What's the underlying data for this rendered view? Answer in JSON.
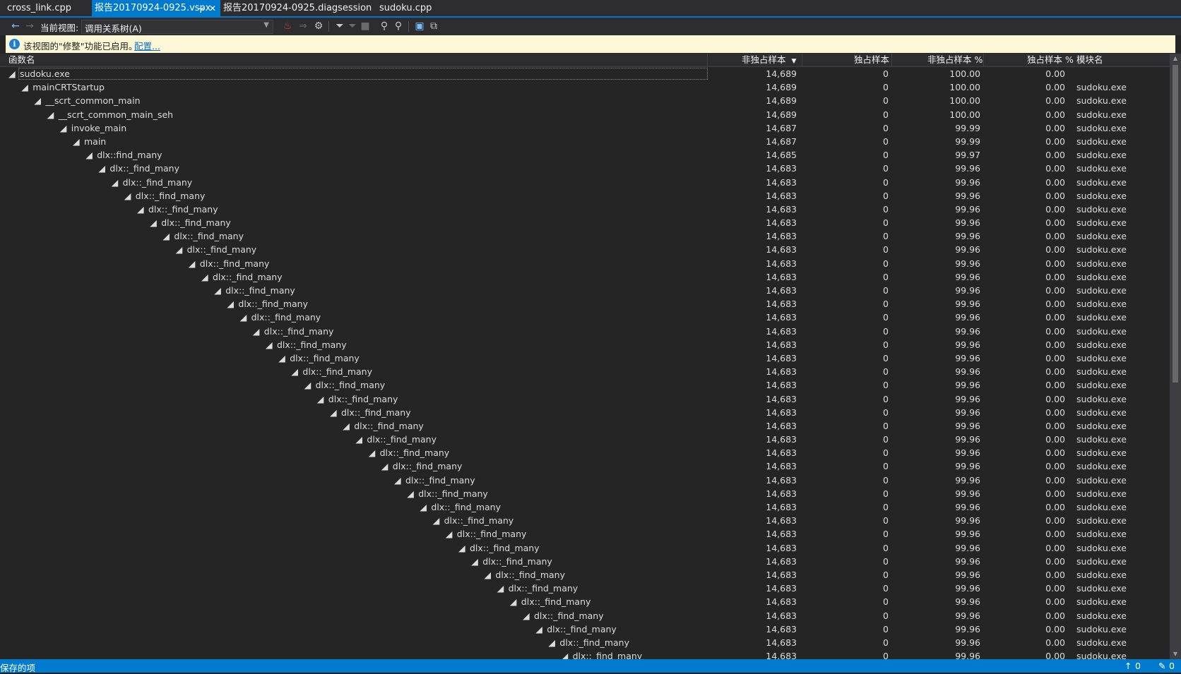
{
  "tabs": [
    {
      "label": "cross_link.cpp",
      "active": false
    },
    {
      "label": "报告20170924-0925.vspx",
      "active": true
    },
    {
      "label": "报告20170924-0925.diagsession",
      "active": false
    },
    {
      "label": "sudoku.cpp",
      "active": false
    }
  ],
  "toolbar": {
    "current_view_label": "当前视图:",
    "view_value": "调用关系树(A)"
  },
  "infobar": {
    "text": "该视图的\"修整\"功能已启用。",
    "link": "配置..."
  },
  "grid": {
    "columns": {
      "function": "函数名",
      "inclusive": "非独占样本",
      "exclusive": "独占样本",
      "inclusive_pct": "非独占样本 %",
      "exclusive_pct": "独占样本 %",
      "module": "模块名"
    },
    "rows": [
      {
        "name": "sudoku.exe",
        "incl": "14,689",
        "excl": "0",
        "inclp": "100.00",
        "exclp": "0.00",
        "module": ""
      },
      {
        "name": "mainCRTStartup",
        "incl": "14,689",
        "excl": "0",
        "inclp": "100.00",
        "exclp": "0.00",
        "module": "sudoku.exe"
      },
      {
        "name": "__scrt_common_main",
        "incl": "14,689",
        "excl": "0",
        "inclp": "100.00",
        "exclp": "0.00",
        "module": "sudoku.exe"
      },
      {
        "name": "__scrt_common_main_seh",
        "incl": "14,689",
        "excl": "0",
        "inclp": "100.00",
        "exclp": "0.00",
        "module": "sudoku.exe"
      },
      {
        "name": "invoke_main",
        "incl": "14,687",
        "excl": "0",
        "inclp": "99.99",
        "exclp": "0.00",
        "module": "sudoku.exe"
      },
      {
        "name": "main",
        "incl": "14,687",
        "excl": "0",
        "inclp": "99.99",
        "exclp": "0.00",
        "module": "sudoku.exe"
      },
      {
        "name": "dlx::find_many",
        "incl": "14,685",
        "excl": "0",
        "inclp": "99.97",
        "exclp": "0.00",
        "module": "sudoku.exe"
      },
      {
        "name": "dlx::_find_many",
        "incl": "14,683",
        "excl": "0",
        "inclp": "99.96",
        "exclp": "0.00",
        "module": "sudoku.exe"
      },
      {
        "name": "dlx::_find_many",
        "incl": "14,683",
        "excl": "0",
        "inclp": "99.96",
        "exclp": "0.00",
        "module": "sudoku.exe"
      },
      {
        "name": "dlx::_find_many",
        "incl": "14,683",
        "excl": "0",
        "inclp": "99.96",
        "exclp": "0.00",
        "module": "sudoku.exe"
      },
      {
        "name": "dlx::_find_many",
        "incl": "14,683",
        "excl": "0",
        "inclp": "99.96",
        "exclp": "0.00",
        "module": "sudoku.exe"
      },
      {
        "name": "dlx::_find_many",
        "incl": "14,683",
        "excl": "0",
        "inclp": "99.96",
        "exclp": "0.00",
        "module": "sudoku.exe"
      },
      {
        "name": "dlx::_find_many",
        "incl": "14,683",
        "excl": "0",
        "inclp": "99.96",
        "exclp": "0.00",
        "module": "sudoku.exe"
      },
      {
        "name": "dlx::_find_many",
        "incl": "14,683",
        "excl": "0",
        "inclp": "99.96",
        "exclp": "0.00",
        "module": "sudoku.exe"
      },
      {
        "name": "dlx::_find_many",
        "incl": "14,683",
        "excl": "0",
        "inclp": "99.96",
        "exclp": "0.00",
        "module": "sudoku.exe"
      },
      {
        "name": "dlx::_find_many",
        "incl": "14,683",
        "excl": "0",
        "inclp": "99.96",
        "exclp": "0.00",
        "module": "sudoku.exe"
      },
      {
        "name": "dlx::_find_many",
        "incl": "14,683",
        "excl": "0",
        "inclp": "99.96",
        "exclp": "0.00",
        "module": "sudoku.exe"
      },
      {
        "name": "dlx::_find_many",
        "incl": "14,683",
        "excl": "0",
        "inclp": "99.96",
        "exclp": "0.00",
        "module": "sudoku.exe"
      },
      {
        "name": "dlx::_find_many",
        "incl": "14,683",
        "excl": "0",
        "inclp": "99.96",
        "exclp": "0.00",
        "module": "sudoku.exe"
      },
      {
        "name": "dlx::_find_many",
        "incl": "14,683",
        "excl": "0",
        "inclp": "99.96",
        "exclp": "0.00",
        "module": "sudoku.exe"
      },
      {
        "name": "dlx::_find_many",
        "incl": "14,683",
        "excl": "0",
        "inclp": "99.96",
        "exclp": "0.00",
        "module": "sudoku.exe"
      },
      {
        "name": "dlx::_find_many",
        "incl": "14,683",
        "excl": "0",
        "inclp": "99.96",
        "exclp": "0.00",
        "module": "sudoku.exe"
      },
      {
        "name": "dlx::_find_many",
        "incl": "14,683",
        "excl": "0",
        "inclp": "99.96",
        "exclp": "0.00",
        "module": "sudoku.exe"
      },
      {
        "name": "dlx::_find_many",
        "incl": "14,683",
        "excl": "0",
        "inclp": "99.96",
        "exclp": "0.00",
        "module": "sudoku.exe"
      },
      {
        "name": "dlx::_find_many",
        "incl": "14,683",
        "excl": "0",
        "inclp": "99.96",
        "exclp": "0.00",
        "module": "sudoku.exe"
      },
      {
        "name": "dlx::_find_many",
        "incl": "14,683",
        "excl": "0",
        "inclp": "99.96",
        "exclp": "0.00",
        "module": "sudoku.exe"
      },
      {
        "name": "dlx::_find_many",
        "incl": "14,683",
        "excl": "0",
        "inclp": "99.96",
        "exclp": "0.00",
        "module": "sudoku.exe"
      },
      {
        "name": "dlx::_find_many",
        "incl": "14,683",
        "excl": "0",
        "inclp": "99.96",
        "exclp": "0.00",
        "module": "sudoku.exe"
      },
      {
        "name": "dlx::_find_many",
        "incl": "14,683",
        "excl": "0",
        "inclp": "99.96",
        "exclp": "0.00",
        "module": "sudoku.exe"
      },
      {
        "name": "dlx::_find_many",
        "incl": "14,683",
        "excl": "0",
        "inclp": "99.96",
        "exclp": "0.00",
        "module": "sudoku.exe"
      },
      {
        "name": "dlx::_find_many",
        "incl": "14,683",
        "excl": "0",
        "inclp": "99.96",
        "exclp": "0.00",
        "module": "sudoku.exe"
      },
      {
        "name": "dlx::_find_many",
        "incl": "14,683",
        "excl": "0",
        "inclp": "99.96",
        "exclp": "0.00",
        "module": "sudoku.exe"
      },
      {
        "name": "dlx::_find_many",
        "incl": "14,683",
        "excl": "0",
        "inclp": "99.96",
        "exclp": "0.00",
        "module": "sudoku.exe"
      },
      {
        "name": "dlx::_find_many",
        "incl": "14,683",
        "excl": "0",
        "inclp": "99.96",
        "exclp": "0.00",
        "module": "sudoku.exe"
      },
      {
        "name": "dlx::_find_many",
        "incl": "14,683",
        "excl": "0",
        "inclp": "99.96",
        "exclp": "0.00",
        "module": "sudoku.exe"
      },
      {
        "name": "dlx::_find_many",
        "incl": "14,683",
        "excl": "0",
        "inclp": "99.96",
        "exclp": "0.00",
        "module": "sudoku.exe"
      },
      {
        "name": "dlx::_find_many",
        "incl": "14,683",
        "excl": "0",
        "inclp": "99.96",
        "exclp": "0.00",
        "module": "sudoku.exe"
      },
      {
        "name": "dlx::_find_many",
        "incl": "14,683",
        "excl": "0",
        "inclp": "99.96",
        "exclp": "0.00",
        "module": "sudoku.exe"
      },
      {
        "name": "dlx::_find_many",
        "incl": "14,683",
        "excl": "0",
        "inclp": "99.96",
        "exclp": "0.00",
        "module": "sudoku.exe"
      },
      {
        "name": "dlx::_find_many",
        "incl": "14,683",
        "excl": "0",
        "inclp": "99.96",
        "exclp": "0.00",
        "module": "sudoku.exe"
      },
      {
        "name": "dlx::_find_many",
        "incl": "14,683",
        "excl": "0",
        "inclp": "99.96",
        "exclp": "0.00",
        "module": "sudoku.exe"
      },
      {
        "name": "dlx::_find_many",
        "incl": "14,683",
        "excl": "0",
        "inclp": "99.96",
        "exclp": "0.00",
        "module": "sudoku.exe"
      },
      {
        "name": "dlx::_find_many",
        "incl": "14,683",
        "excl": "0",
        "inclp": "99.96",
        "exclp": "0.00",
        "module": "sudoku.exe"
      },
      {
        "name": "dlx::_find_many",
        "incl": "14,683",
        "excl": "0",
        "inclp": "99.96",
        "exclp": "0.00",
        "module": "sudoku.exe"
      }
    ]
  },
  "statusbar": {
    "text": "保存的项",
    "up_count": "0",
    "edit_count": "0"
  }
}
